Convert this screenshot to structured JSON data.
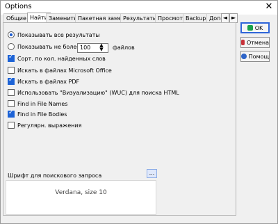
{
  "window": {
    "title": "Options",
    "close": "✕"
  },
  "tabs": [
    "Общие",
    "Найти",
    "Заменить",
    "Пакетная замена",
    "Результаты",
    "Просмотр",
    "Backup",
    "Допо"
  ],
  "tab_arrows": [
    "◄",
    "►"
  ],
  "search": {
    "radio_all_label": "Показывать все результаты",
    "radio_limit_label": "Показывать не более",
    "limit_value": "100",
    "limit_unit": "файлов",
    "spin_up": "▲",
    "spin_down": "▼"
  },
  "checkboxes": [
    {
      "label": "Сорт. по кол. найденных слов",
      "checked": true
    },
    {
      "label": "Искать в файлах Microsoft Office",
      "checked": false
    },
    {
      "label": "Искать в файлах PDF",
      "checked": true
    },
    {
      "label": "Использовать \"Визуализацию\" (WUC) для поиска HTML",
      "checked": false
    },
    {
      "label": "Find in File Names",
      "checked": false
    },
    {
      "label": "Find in File Bodies",
      "checked": true
    },
    {
      "label": "Регулярн. выражения",
      "checked": false
    }
  ],
  "font": {
    "label": "Шрифт для поискового запроса",
    "button": "...",
    "preview": "Verdana, size 10"
  },
  "buttons": {
    "ok": "OK",
    "cancel": "Отмена",
    "help": "Помощ"
  },
  "colors": {
    "accent": "#2f65d8",
    "checkbox_on": "#1d63d6"
  }
}
